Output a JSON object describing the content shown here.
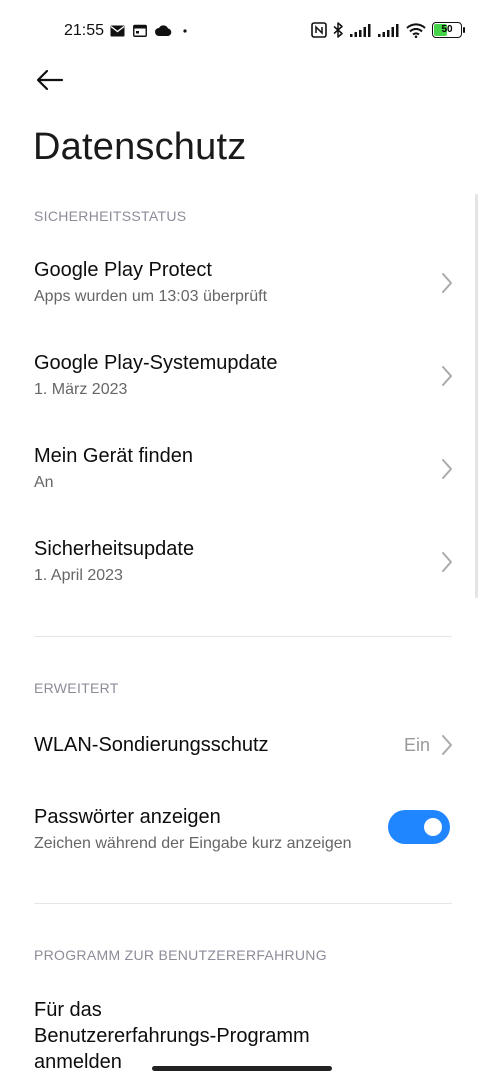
{
  "status_bar": {
    "time": "21:55",
    "left_icons": [
      "mail-icon",
      "calendar-icon",
      "cloud-icon",
      "dot-icon"
    ],
    "right_icons": [
      "nfc-icon",
      "bluetooth-icon",
      "signal-icon",
      "signal-icon",
      "wifi-icon",
      "battery-icon"
    ],
    "battery_level": "50"
  },
  "header": {
    "title": "Datenschutz"
  },
  "sections": {
    "security_status": {
      "label": "SICHERHEITSSTATUS",
      "items": [
        {
          "title": "Google Play Protect",
          "subtitle": "Apps wurden um 13:03 überprüft"
        },
        {
          "title": "Google Play-Systemupdate",
          "subtitle": "1. März 2023"
        },
        {
          "title": "Mein Gerät finden",
          "subtitle": "An"
        },
        {
          "title": "Sicherheitsupdate",
          "subtitle": "1. April 2023"
        }
      ]
    },
    "advanced": {
      "label": "ERWEITERT",
      "wlan": {
        "title": "WLAN-Sondierungsschutz",
        "value": "Ein"
      },
      "passwords": {
        "title": "Passwörter anzeigen",
        "subtitle": "Zeichen während der Eingabe kurz anzeigen",
        "enabled": true
      }
    },
    "ux_program": {
      "label": "PROGRAMM ZUR BENUTZERERFAHRUNG",
      "item": {
        "title_line1": "Für das",
        "title_line2": "Benutzererfahrungs-Programm",
        "title_line3": "anmelden"
      }
    }
  },
  "colors": {
    "accent": "#1f86ff",
    "section_header": "#8c8c99",
    "battery_fill": "#45d34a"
  }
}
